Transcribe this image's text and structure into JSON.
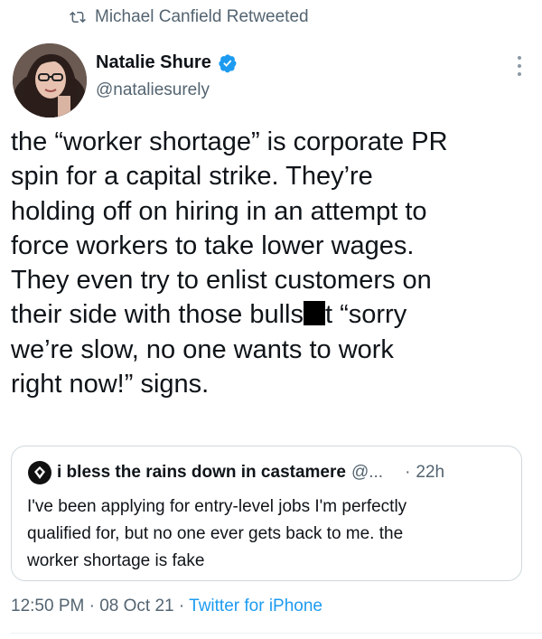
{
  "retweet": {
    "icon": "retweet-icon",
    "text": "Michael Canfield Retweeted"
  },
  "author": {
    "display_name": "Natalie Shure",
    "handle": "@nataliesurely",
    "verified": true
  },
  "tweet": {
    "lines": [
      "the “worker shortage” is corporate PR",
      "spin for a capital strike. They’re",
      "holding off on hiring in an attempt to",
      "force workers to take lower wages.",
      "They even try to enlist customers on",
      "their side with those bulls",
      "t “sorry",
      "we’re slow, no one wants to work",
      "right now!” signs."
    ]
  },
  "quote": {
    "name": "i bless the rains down in castamere",
    "handle": "@...",
    "separator": "·",
    "time": "22h",
    "lines": [
      "I've been applying for entry-level jobs I'm perfectly",
      "qualified for, but no one ever gets back to me. the",
      "worker shortage is fake"
    ]
  },
  "meta": {
    "time": "12:50 PM",
    "dot1": " · ",
    "date": "08 Oct 21",
    "dot2": " · ",
    "source": "Twitter for iPhone"
  },
  "colors": {
    "text": "#0f1419",
    "muted": "#536471",
    "link": "#1d9bf0",
    "verified": "#1d9bf0",
    "border": "#cfd9de"
  }
}
